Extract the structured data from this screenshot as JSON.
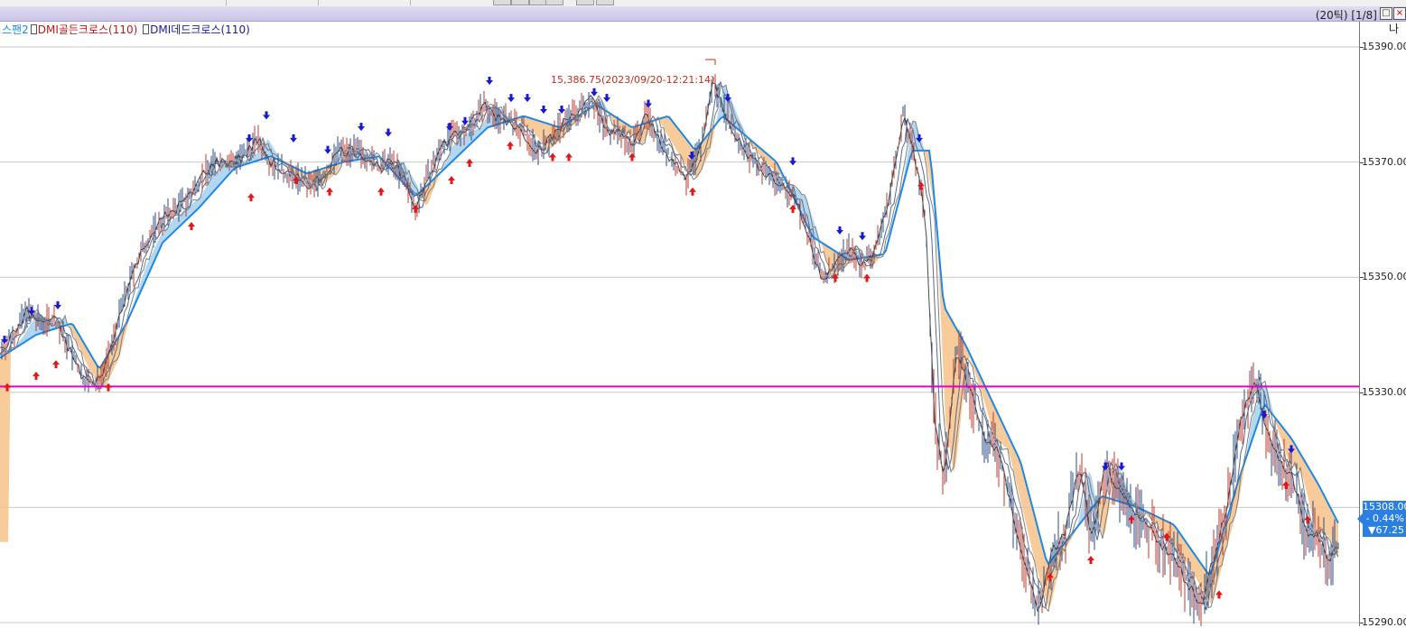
{
  "window": {
    "info": "(20틱) [1/8]",
    "axis_top": "나"
  },
  "legend": {
    "item1": "스팬2",
    "item2": "DMI골든크로스(110)",
    "item3": "DMI데드크로스(110)"
  },
  "annotation": "15,386.75(2023/09/20-12:21:14)",
  "price_tag": {
    "price": "15308.00",
    "change_pct": "- 0.44%",
    "change": "▼67.25"
  },
  "chart_data": {
    "type": "line",
    "ylim": [
      15290,
      15390
    ],
    "yticks": [
      "15390.00",
      "15370.00",
      "15350.00",
      "15330.00",
      "15290.00"
    ],
    "horizontal_line": 15331,
    "colors": {
      "price": "#3a3a6a",
      "span_fill_up": "#aad4f0",
      "span_fill_down": "#f7c590",
      "span_line": "#1e88e5",
      "hline": "#e000d0",
      "golden": "#e01818",
      "dead": "#1818d0"
    },
    "series": [
      {
        "points": [
          [
            0,
            15337
          ],
          [
            15,
            15340
          ],
          [
            30,
            15344
          ],
          [
            45,
            15342
          ],
          [
            60,
            15343
          ],
          [
            75,
            15338
          ],
          [
            90,
            15333
          ],
          [
            105,
            15331
          ],
          [
            120,
            15336
          ],
          [
            135,
            15345
          ],
          [
            150,
            15352
          ],
          [
            165,
            15357
          ],
          [
            180,
            15360
          ],
          [
            195,
            15362
          ],
          [
            210,
            15364
          ],
          [
            225,
            15368
          ],
          [
            240,
            15370
          ],
          [
            255,
            15370
          ],
          [
            270,
            15371
          ],
          [
            285,
            15374
          ],
          [
            300,
            15370
          ],
          [
            315,
            15368
          ],
          [
            330,
            15367
          ],
          [
            345,
            15366
          ],
          [
            360,
            15368
          ],
          [
            375,
            15372
          ],
          [
            390,
            15372
          ],
          [
            405,
            15371
          ],
          [
            420,
            15369
          ],
          [
            435,
            15370
          ],
          [
            450,
            15366
          ],
          [
            460,
            15362
          ],
          [
            475,
            15368
          ],
          [
            490,
            15373
          ],
          [
            505,
            15375
          ],
          [
            520,
            15376
          ],
          [
            535,
            15380
          ],
          [
            550,
            15378
          ],
          [
            565,
            15377
          ],
          [
            580,
            15375
          ],
          [
            595,
            15372
          ],
          [
            610,
            15374
          ],
          [
            625,
            15377
          ],
          [
            640,
            15379
          ],
          [
            655,
            15381
          ],
          [
            670,
            15376
          ],
          [
            685,
            15375
          ],
          [
            700,
            15373
          ],
          [
            715,
            15378
          ],
          [
            730,
            15374
          ],
          [
            745,
            15370
          ],
          [
            760,
            15367
          ],
          [
            775,
            15372
          ],
          [
            790,
            15384
          ],
          [
            805,
            15378
          ],
          [
            820,
            15373
          ],
          [
            835,
            15370
          ],
          [
            850,
            15368
          ],
          [
            865,
            15366
          ],
          [
            880,
            15364
          ],
          [
            895,
            15357
          ],
          [
            910,
            15350
          ],
          [
            925,
            15352
          ],
          [
            940,
            15355
          ],
          [
            955,
            15352
          ],
          [
            970,
            15355
          ],
          [
            985,
            15364
          ],
          [
            1000,
            15378
          ],
          [
            1012,
            15372
          ],
          [
            1025,
            15360
          ],
          [
            1035,
            15325
          ],
          [
            1045,
            15315
          ],
          [
            1060,
            15337
          ],
          [
            1075,
            15330
          ],
          [
            1090,
            15322
          ],
          [
            1105,
            15320
          ],
          [
            1120,
            15310
          ],
          [
            1135,
            15300
          ],
          [
            1150,
            15292
          ],
          [
            1165,
            15302
          ],
          [
            1180,
            15306
          ],
          [
            1195,
            15317
          ],
          [
            1210,
            15304
          ],
          [
            1225,
            15318
          ],
          [
            1240,
            15312
          ],
          [
            1255,
            15309
          ],
          [
            1270,
            15307
          ],
          [
            1285,
            15304
          ],
          [
            1300,
            15301
          ],
          [
            1315,
            15297
          ],
          [
            1330,
            15293
          ],
          [
            1345,
            15302
          ],
          [
            1360,
            15311
          ],
          [
            1375,
            15326
          ],
          [
            1390,
            15332
          ],
          [
            1400,
            15325
          ],
          [
            1415,
            15318
          ],
          [
            1430,
            15316
          ],
          [
            1445,
            15306
          ],
          [
            1460,
            15305
          ],
          [
            1470,
            15301
          ],
          [
            1483,
            15304
          ]
        ]
      }
    ],
    "span": [
      [
        0,
        15336
      ],
      [
        40,
        15340
      ],
      [
        80,
        15342
      ],
      [
        110,
        15334
      ],
      [
        140,
        15342
      ],
      [
        180,
        15356
      ],
      [
        220,
        15362
      ],
      [
        260,
        15369
      ],
      [
        300,
        15371
      ],
      [
        340,
        15368
      ],
      [
        380,
        15370
      ],
      [
        420,
        15371
      ],
      [
        460,
        15364
      ],
      [
        500,
        15370
      ],
      [
        540,
        15376
      ],
      [
        580,
        15378
      ],
      [
        620,
        15376
      ],
      [
        660,
        15380
      ],
      [
        700,
        15376
      ],
      [
        740,
        15378
      ],
      [
        770,
        15372
      ],
      [
        800,
        15378
      ],
      [
        830,
        15374
      ],
      [
        860,
        15370
      ],
      [
        900,
        15357
      ],
      [
        940,
        15353
      ],
      [
        980,
        15354
      ],
      [
        1010,
        15372
      ],
      [
        1030,
        15372
      ],
      [
        1045,
        15345
      ],
      [
        1070,
        15338
      ],
      [
        1100,
        15328
      ],
      [
        1130,
        15318
      ],
      [
        1160,
        15300
      ],
      [
        1190,
        15306
      ],
      [
        1220,
        15312
      ],
      [
        1260,
        15310
      ],
      [
        1300,
        15307
      ],
      [
        1340,
        15298
      ],
      [
        1370,
        15314
      ],
      [
        1400,
        15328
      ],
      [
        1430,
        15322
      ],
      [
        1460,
        15314
      ],
      [
        1483,
        15307
      ]
    ],
    "golden_cross": [
      [
        8,
        15333
      ],
      [
        40,
        15335
      ],
      [
        62,
        15337
      ],
      [
        120,
        15333
      ],
      [
        212,
        15361
      ],
      [
        278,
        15366
      ],
      [
        328,
        15369
      ],
      [
        365,
        15367
      ],
      [
        422,
        15367
      ],
      [
        460,
        15364
      ],
      [
        500,
        15369
      ],
      [
        520,
        15372
      ],
      [
        565,
        15375
      ],
      [
        612,
        15373
      ],
      [
        630,
        15373
      ],
      [
        700,
        15373
      ],
      [
        767,
        15367
      ],
      [
        878,
        15364
      ],
      [
        925,
        15352
      ],
      [
        960,
        15352
      ],
      [
        1020,
        15368
      ],
      [
        1163,
        15300
      ],
      [
        1208,
        15303
      ],
      [
        1253,
        15310
      ],
      [
        1292,
        15307
      ],
      [
        1350,
        15297
      ],
      [
        1424,
        15316
      ],
      [
        1448,
        15310
      ]
    ],
    "dead_cross": [
      [
        5,
        15337
      ],
      [
        35,
        15342
      ],
      [
        64,
        15343
      ],
      [
        295,
        15376
      ],
      [
        276,
        15372
      ],
      [
        325,
        15372
      ],
      [
        363,
        15370
      ],
      [
        400,
        15374
      ],
      [
        430,
        15373
      ],
      [
        498,
        15374
      ],
      [
        515,
        15375
      ],
      [
        542,
        15382
      ],
      [
        566,
        15379
      ],
      [
        584,
        15379
      ],
      [
        602,
        15377
      ],
      [
        622,
        15377
      ],
      [
        658,
        15380
      ],
      [
        672,
        15379
      ],
      [
        718,
        15378
      ],
      [
        766,
        15369
      ],
      [
        806,
        15379
      ],
      [
        878,
        15368
      ],
      [
        930,
        15356
      ],
      [
        955,
        15355
      ],
      [
        1018,
        15372
      ],
      [
        1224,
        15315
      ],
      [
        1242,
        15315
      ],
      [
        1400,
        15324
      ],
      [
        1430,
        15318
      ]
    ]
  }
}
